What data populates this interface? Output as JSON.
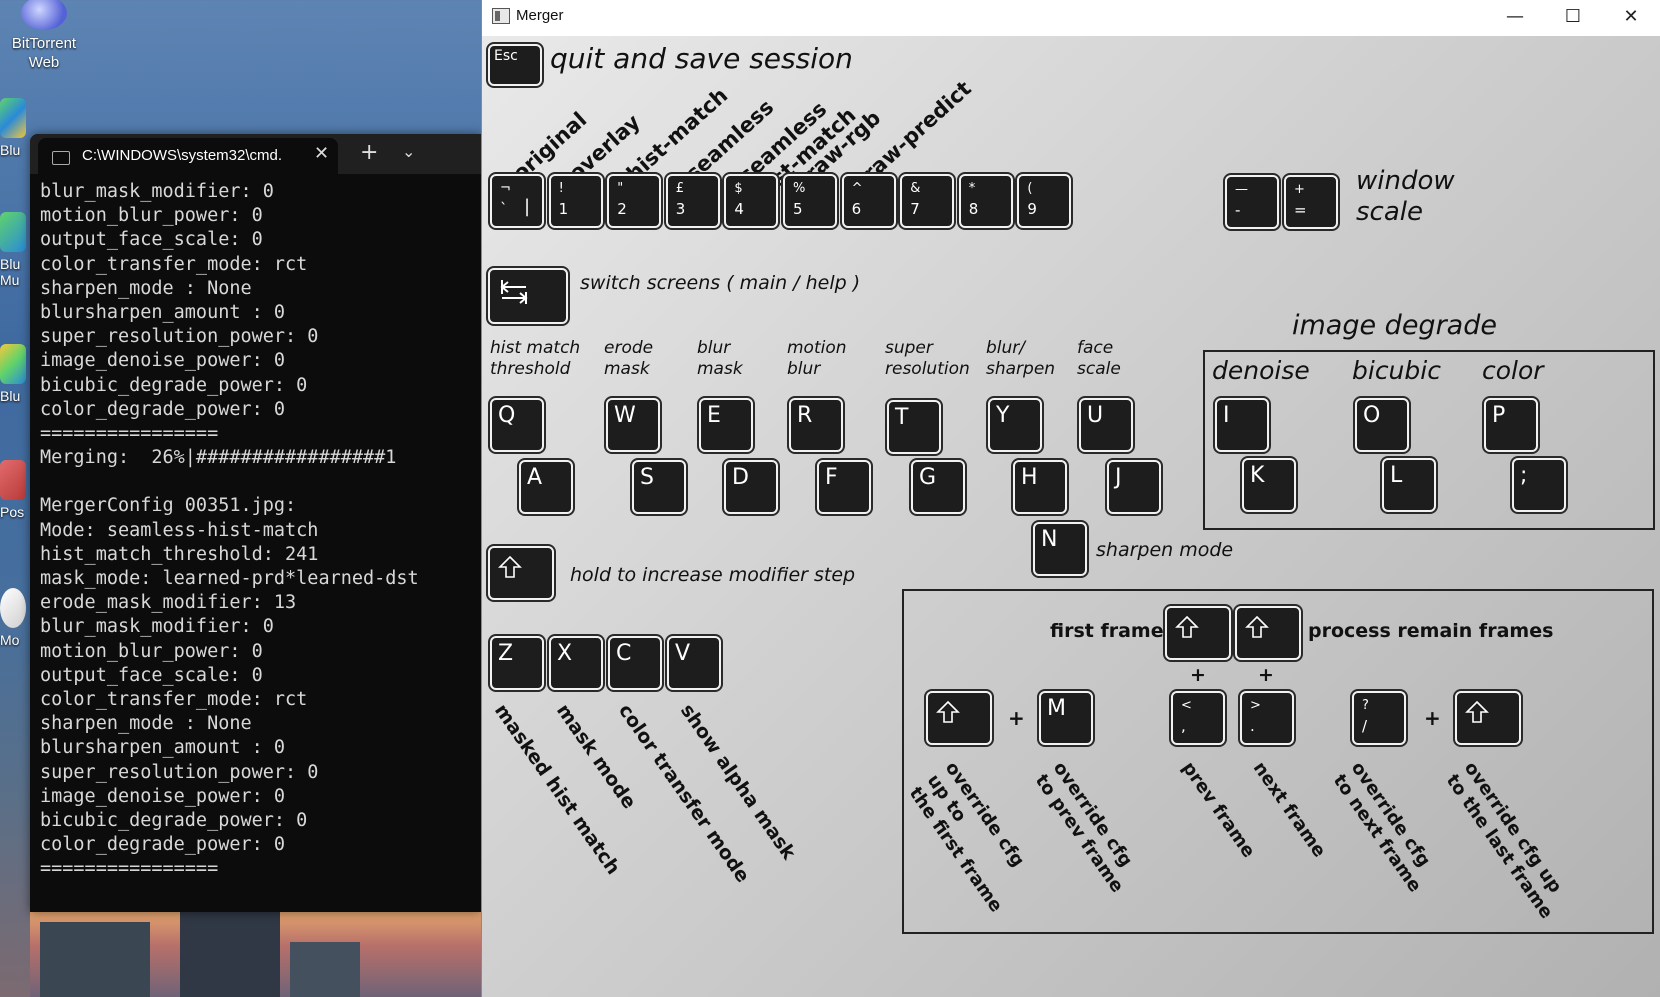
{
  "desktop": {
    "icons": [
      {
        "label_1": "BitTorrent",
        "label_2": "Web"
      }
    ],
    "partial_labels": [
      "Blu",
      "Blu",
      "Mu",
      "Blu",
      "Pos",
      "Mo"
    ]
  },
  "terminal": {
    "tab_title": "C:\\WINDOWS\\system32\\cmd.",
    "close_glyph": "✕",
    "new_tab_glyph": "+",
    "dropdown_glyph": "⌄",
    "lines": [
      "blur_mask_modifier: 0",
      "motion_blur_power: 0",
      "output_face_scale: 0",
      "color_transfer_mode: rct",
      "sharpen_mode : None",
      "blursharpen_amount : 0",
      "super_resolution_power: 0",
      "image_denoise_power: 0",
      "bicubic_degrade_power: 0",
      "color_degrade_power: 0",
      "================",
      "Merging:  26%|#################1",
      "",
      "MergerConfig 00351.jpg:",
      "Mode: seamless-hist-match",
      "hist_match_threshold: 241",
      "mask_mode: learned-prd*learned-dst",
      "erode_mask_modifier: 13",
      "blur_mask_modifier: 0",
      "motion_blur_power: 0",
      "output_face_scale: 0",
      "color_transfer_mode: rct",
      "sharpen_mode : None",
      "blursharpen_amount : 0",
      "super_resolution_power: 0",
      "image_denoise_power: 0",
      "bicubic_degrade_power: 0",
      "color_degrade_power: 0",
      "================"
    ]
  },
  "merger": {
    "title": "Merger",
    "window_buttons": {
      "minimize": "—",
      "maximize": "☐",
      "close": "✕"
    },
    "esc": {
      "key": "Esc",
      "label": "quit and save session"
    },
    "modes": [
      "original",
      "overlay",
      "hist-match",
      "seamless",
      "seamless\nhist-match",
      "raw-rgb",
      "raw-predict"
    ],
    "number_keys": [
      {
        "top": "¬",
        "bottom": "`",
        "side": "|"
      },
      {
        "top": "!",
        "bottom": "1"
      },
      {
        "top": "\"",
        "bottom": "2"
      },
      {
        "top": "£",
        "bottom": "3"
      },
      {
        "top": "$",
        "bottom": "4"
      },
      {
        "top": "%",
        "bottom": "5"
      },
      {
        "top": "^",
        "bottom": "6"
      },
      {
        "top": "&",
        "bottom": "7"
      },
      {
        "top": "*",
        "bottom": "8"
      },
      {
        "top": "(",
        "bottom": "9"
      }
    ],
    "scale_keys": [
      {
        "top": "—",
        "bottom": "-"
      },
      {
        "top": "+",
        "bottom": "="
      }
    ],
    "window_scale_label": "window\nscale",
    "switch_label": "switch screens ( main / help )",
    "modifiers": [
      {
        "label": "hist match\nthreshold",
        "up": "Q",
        "down": "A"
      },
      {
        "label": "erode\nmask",
        "up": "W",
        "down": "S"
      },
      {
        "label": "blur\nmask",
        "up": "E",
        "down": "D"
      },
      {
        "label": "motion\nblur",
        "up": "R",
        "down": "F"
      },
      {
        "label": "super\nresolution",
        "up": "T",
        "down": "G"
      },
      {
        "label": "blur/\nsharpen",
        "up": "Y",
        "down": "H"
      },
      {
        "label": "face\nscale",
        "up": "U",
        "down": "J"
      }
    ],
    "degrade": {
      "title": "image degrade",
      "groups": [
        {
          "label": "denoise",
          "up": "I",
          "down": "K"
        },
        {
          "label": "bicubic",
          "up": "O",
          "down": "L"
        },
        {
          "label": "color",
          "up": "P",
          "down": ";"
        }
      ]
    },
    "sharpen": {
      "key": "N",
      "label": "sharpen mode"
    },
    "shift_label": "hold to increase modifier step",
    "zxcv": [
      {
        "key": "Z",
        "label": "masked hist match"
      },
      {
        "key": "X",
        "label": "mask mode"
      },
      {
        "key": "C",
        "label": "color transfer mode"
      },
      {
        "key": "V",
        "label": "show alpha mask"
      }
    ],
    "frames": {
      "first_frame": "first frame",
      "process_remain": "process remain frames",
      "plus": "+",
      "m_key": "M",
      "prev_key": {
        "top": "<",
        "bottom": ","
      },
      "next_key": {
        "top": ">",
        "bottom": "."
      },
      "q_key": {
        "top": "?",
        "bottom": "/"
      },
      "labels": [
        "override cfg\nup to\nthe first frame",
        "override cfg\nto prev frame",
        "prev frame",
        "next frame",
        "override cfg\nto next frame",
        "override cfg up\nto the last frame"
      ]
    }
  }
}
